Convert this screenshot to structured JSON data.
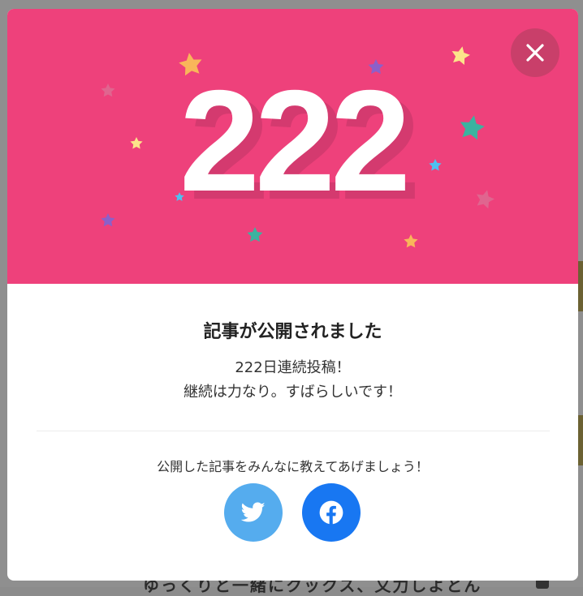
{
  "modal": {
    "count": "222",
    "title": "記事が公開されました",
    "streak_line": "222日連続投稿！",
    "praise_line": "継続は力なり。すばらしいです！",
    "share_prompt": "公開した記事をみんなに教えてあげましょう！",
    "hero_color": "#ee417b",
    "close_icon": "close-icon",
    "share_buttons": [
      {
        "service": "twitter",
        "icon": "twitter-bird-icon",
        "color": "#55acee"
      },
      {
        "service": "facebook",
        "icon": "facebook-f-icon",
        "color": "#1877f2"
      }
    ]
  },
  "background": {
    "partial_text": "ゆっくりと一緒にクックス、又力しよとん"
  }
}
